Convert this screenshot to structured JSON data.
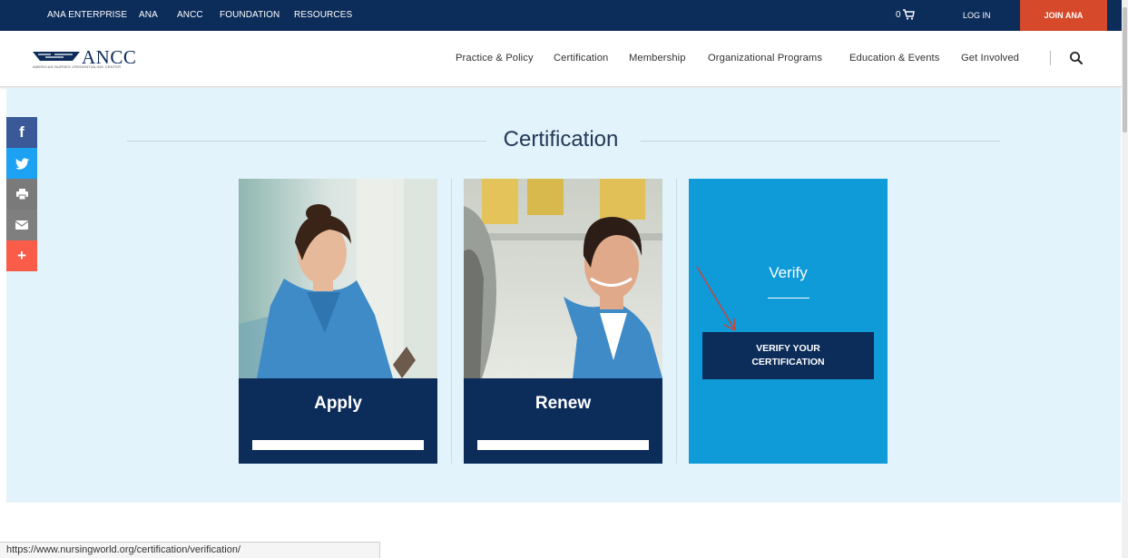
{
  "topbar": {
    "links": [
      "ANA ENTERPRISE",
      "ANA",
      "ANCC",
      "FOUNDATION",
      "RESOURCES"
    ],
    "cart_count": "0",
    "login_label": "LOG IN",
    "join_label": "JOIN ANA"
  },
  "logo": {
    "wordmark": "ANCC",
    "tagline": "AMERICAN NURSES CREDENTIALING CENTER"
  },
  "nav": {
    "items": [
      "Practice & Policy",
      "Certification",
      "Membership",
      "Organizational Programs",
      "Education & Events",
      "Get Involved"
    ],
    "search_icon": "search-icon"
  },
  "social": {
    "items": [
      {
        "icon": "facebook-icon",
        "glyph": "f",
        "color": "#3b5998"
      },
      {
        "icon": "twitter-icon",
        "glyph": "",
        "color": "#1da1f2"
      },
      {
        "icon": "print-icon",
        "glyph": "",
        "color": "#7a7a7a"
      },
      {
        "icon": "email-icon",
        "glyph": "",
        "color": "#7f7f7f"
      },
      {
        "icon": "more-icon",
        "glyph": "+",
        "color": "#f95d4a"
      }
    ]
  },
  "main": {
    "section_title": "Certification",
    "cards": [
      {
        "label": "Apply"
      },
      {
        "label": "Renew"
      }
    ],
    "verify": {
      "title": "Verify",
      "button_label": "VERIFY YOUR CERTIFICATION"
    }
  },
  "status_bar": {
    "url": "https://www.nursingworld.org/certification/verification/"
  },
  "colors": {
    "brand_navy": "#0c2c5a",
    "join_orange": "#d6492a",
    "verify_blue": "#0f9ad8",
    "hero_bg": "#e3f3fb"
  }
}
